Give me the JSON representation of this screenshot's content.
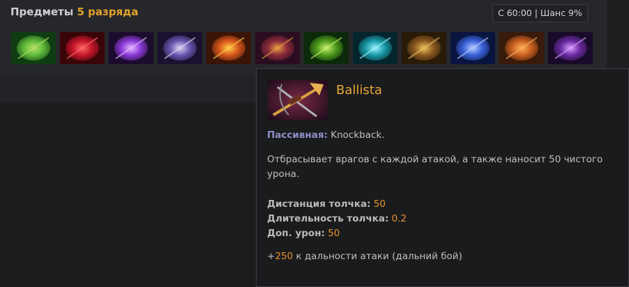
{
  "header": {
    "title_prefix": "Предметы",
    "title_accent": "5 разряда",
    "timing": "С 60:00 | Шанс 9%"
  },
  "items": [
    {
      "icon": "green-armor-icon",
      "colors": [
        "#0f3d12",
        "#5fbb3a",
        "#b8e06a"
      ]
    },
    {
      "icon": "red-blades-icon",
      "colors": [
        "#3a0508",
        "#c4152a",
        "#ff6a6a"
      ]
    },
    {
      "icon": "purple-spike-icon",
      "colors": [
        "#1b0b2c",
        "#8a3ad8",
        "#e8b8ff"
      ]
    },
    {
      "icon": "silver-orb-icon",
      "colors": [
        "#1a1030",
        "#6a58b0",
        "#dcd8f0"
      ]
    },
    {
      "icon": "fire-ring-icon",
      "colors": [
        "#3a1406",
        "#d8561a",
        "#ffd04a"
      ]
    },
    {
      "icon": "ballista-icon",
      "colors": [
        "#2a0d20",
        "#8a2a3a",
        "#e8a040"
      ]
    },
    {
      "icon": "green-tome-icon",
      "colors": [
        "#0b2a0a",
        "#4f9a1c",
        "#c8f070"
      ]
    },
    {
      "icon": "cyan-hammer-icon",
      "colors": [
        "#05252c",
        "#1a9aa8",
        "#9af4ff"
      ]
    },
    {
      "icon": "dark-armor-icon",
      "colors": [
        "#2a1a08",
        "#8a5a20",
        "#f0c060"
      ]
    },
    {
      "icon": "blue-gem-icon",
      "colors": [
        "#0a1440",
        "#3a62d8",
        "#b8ccff"
      ]
    },
    {
      "icon": "orange-gauntlet-icon",
      "colors": [
        "#3a1a0a",
        "#c86020",
        "#ffb060"
      ]
    },
    {
      "icon": "violet-book-icon",
      "colors": [
        "#180a28",
        "#6a2aa0",
        "#d8a0ff"
      ]
    }
  ],
  "tooltip": {
    "name": "Ballista",
    "passive_label": "Пассивная:",
    "passive_name": "Knockback.",
    "description_line1": "Отбрасывает врагов с каждой атакой, а также наносит 50 чистого",
    "description_line2": "урона.",
    "stats": [
      {
        "label": "Дистанция толчка:",
        "value": "50"
      },
      {
        "label": "Длительность толчка:",
        "value": "0.2"
      },
      {
        "label": "Доп. урон:",
        "value": "50"
      }
    ],
    "bonus_sign": "+",
    "bonus_value": "250",
    "bonus_text": "к дальности атаки (дальний бой)"
  }
}
